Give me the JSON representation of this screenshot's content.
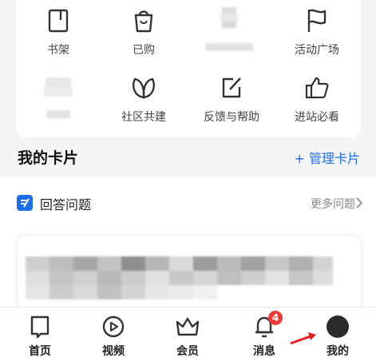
{
  "top_grid": {
    "row1": [
      {
        "label": "书架",
        "icon": "bookshelf-icon"
      },
      {
        "label": "已购",
        "icon": "shopping-bag-icon"
      },
      {
        "label": "",
        "icon": "blurred-item-icon"
      },
      {
        "label": "活动广场",
        "icon": "flag-icon"
      }
    ],
    "row2": [
      {
        "label": "",
        "icon": "blurred-item-icon"
      },
      {
        "label": "社区共建",
        "icon": "community-leaf-icon"
      },
      {
        "label": "反馈与帮助",
        "icon": "feedback-edit-icon"
      },
      {
        "label": "进站必看",
        "icon": "thumbs-up-icon"
      }
    ]
  },
  "cards_section": {
    "title": "我的卡片",
    "manage_label": "+ 管理卡片"
  },
  "answer_card": {
    "title": "回答问题",
    "more_label": "更多问题"
  },
  "tabbar": {
    "items": [
      {
        "label": "首页",
        "icon": "home-icon"
      },
      {
        "label": "视频",
        "icon": "video-play-icon"
      },
      {
        "label": "会员",
        "icon": "crown-icon"
      },
      {
        "label": "消息",
        "icon": "bell-icon",
        "badge": "4"
      },
      {
        "label": "我的",
        "icon": "avatar-icon"
      }
    ]
  },
  "colors": {
    "accent": "#1e6ee8",
    "badge": "#ef3b35",
    "background": "#f4f5f7"
  }
}
